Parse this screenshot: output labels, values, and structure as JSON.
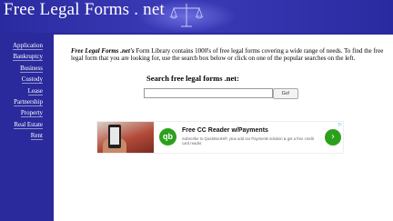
{
  "site": {
    "title": "Free Legal Forms . net"
  },
  "sidebar": {
    "items": [
      {
        "label": "Application"
      },
      {
        "label": "Bankruptcy"
      },
      {
        "label": "Business"
      },
      {
        "label": "Custody"
      },
      {
        "label": "Lease"
      },
      {
        "label": "Partnership"
      },
      {
        "label": "Property"
      },
      {
        "label": "Real Estate"
      },
      {
        "label": "Rent"
      }
    ]
  },
  "main": {
    "intro_brand": "Free Legal Forms .net's",
    "intro_text": " Form Library contains 1000's of free legal forms covering a wide range of needs. To find the free legal form that you are looking for, use the search box below or click on one of the popular searches on the left.",
    "search_heading": "Search free legal forms .net:",
    "search_value": "",
    "go_label": "Go!"
  },
  "ad": {
    "logo_text": "qb",
    "title": "Free CC Reader w/Payments",
    "body": "Subscribe to QuickBooks®, plus add our Payments solution & get a free credit card reader.",
    "arrow_icon": "arrow-right-icon",
    "badge_icon": "adchoices-icon",
    "accent_color": "#2ca01c"
  }
}
